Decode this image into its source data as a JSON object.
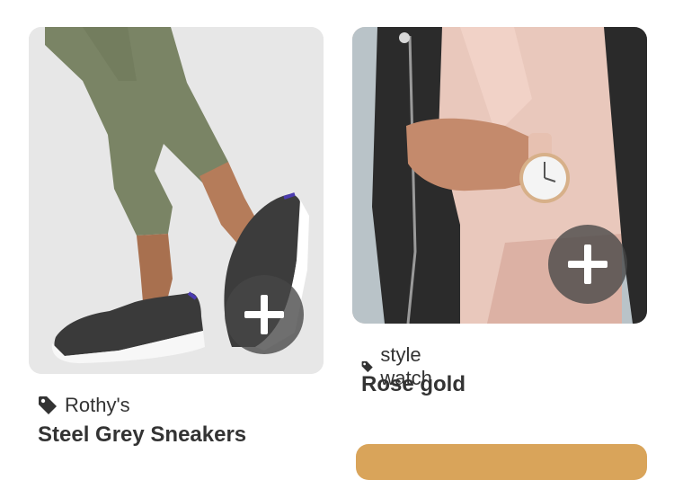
{
  "cards": [
    {
      "brand": "Rothy's",
      "title": "Steel Grey Sneakers",
      "image_icon": "shoes-photo",
      "add_icon": "plus-icon",
      "tag_icon": "tag-icon"
    },
    {
      "brand": "style watch",
      "title": "Rose gold",
      "image_icon": "watch-photo",
      "add_icon": "plus-icon",
      "tag_icon": "tag-icon"
    }
  ],
  "colors": {
    "text": "#333333",
    "overlay": "#464646"
  }
}
